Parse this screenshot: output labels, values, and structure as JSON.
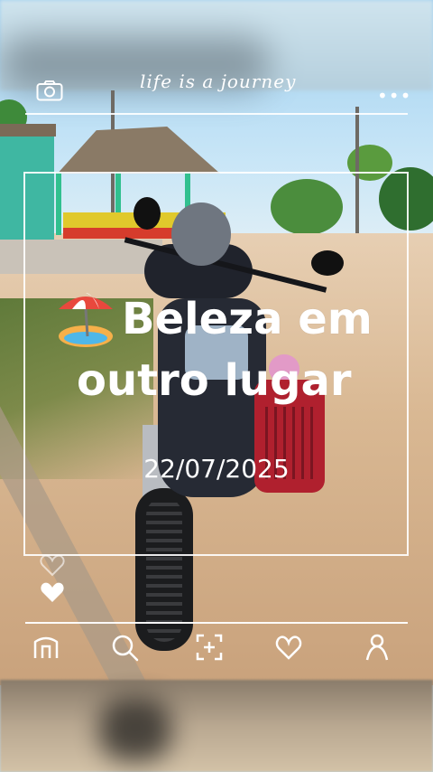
{
  "header": {
    "title": "life is a journey",
    "camera_icon": "camera-icon",
    "menu_icon": "more-dots-icon"
  },
  "post": {
    "headline_line1": "Beleza em",
    "headline_line2": "outro lugar",
    "emoji_icon": "beach-umbrella-icon",
    "date": "22/07/2025"
  },
  "reactions": {
    "like_icon": "heart-icon"
  },
  "nav": {
    "items": [
      {
        "icon": "home-icon"
      },
      {
        "icon": "search-icon"
      },
      {
        "icon": "add-icon"
      },
      {
        "icon": "favorites-icon"
      },
      {
        "icon": "profile-icon"
      }
    ]
  },
  "colors": {
    "overlay_white": "#ffffff",
    "sky": "#9fd0f0",
    "ground": "#d9b893"
  }
}
